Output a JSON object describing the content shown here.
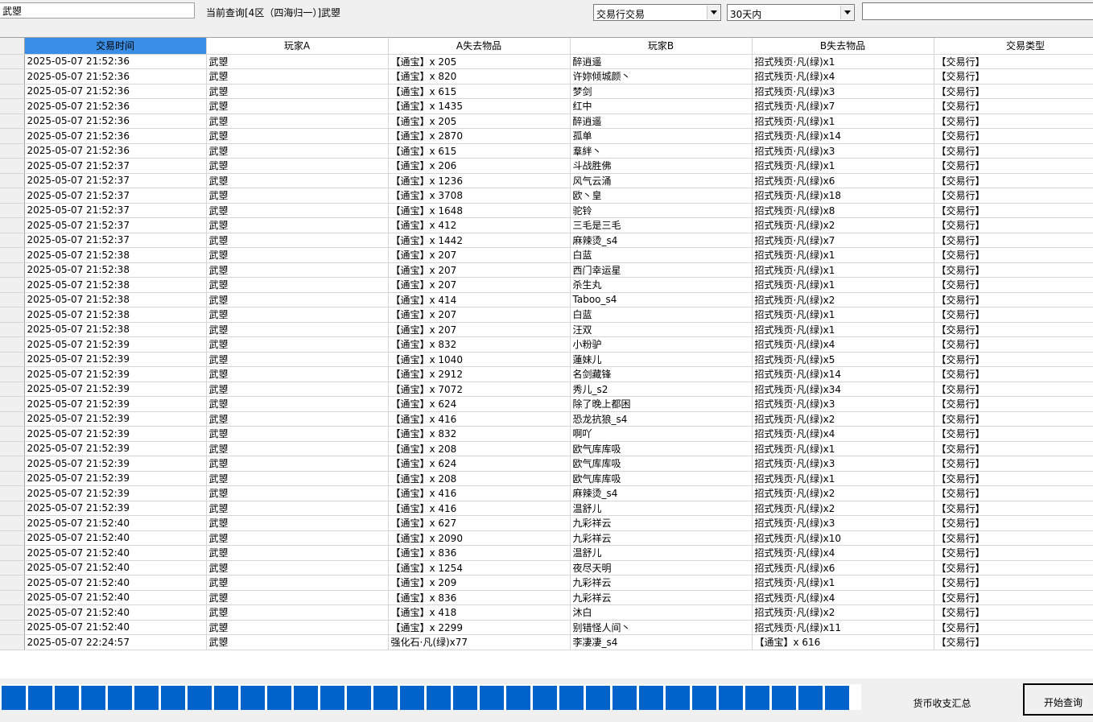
{
  "search": {
    "player_name": "武曌",
    "query_label": "当前查询[4区（四海归一）]武曌",
    "trade_type": "交易行交易",
    "time_range": "30天内",
    "filter_value": ""
  },
  "table": {
    "columns": [
      "交易时间",
      "玩家A",
      "A失去物品",
      "玩家B",
      "B失去物品",
      "交易类型"
    ],
    "rows": [
      [
        "2025-05-07 21:52:36",
        "武曌",
        "【通宝】x 205",
        "醉逍遥",
        "招式残页·凡(绿)x1",
        "【交易行】"
      ],
      [
        "2025-05-07 21:52:36",
        "武曌",
        "【通宝】x 820",
        "许妳倾城颜丶",
        "招式残页·凡(绿)x4",
        "【交易行】"
      ],
      [
        "2025-05-07 21:52:36",
        "武曌",
        "【通宝】x 615",
        "梦剑",
        "招式残页·凡(绿)x3",
        "【交易行】"
      ],
      [
        "2025-05-07 21:52:36",
        "武曌",
        "【通宝】x 1435",
        "红中",
        "招式残页·凡(绿)x7",
        "【交易行】"
      ],
      [
        "2025-05-07 21:52:36",
        "武曌",
        "【通宝】x 205",
        "醉逍遥",
        "招式残页·凡(绿)x1",
        "【交易行】"
      ],
      [
        "2025-05-07 21:52:36",
        "武曌",
        "【通宝】x 2870",
        "孤单",
        "招式残页·凡(绿)x14",
        "【交易行】"
      ],
      [
        "2025-05-07 21:52:36",
        "武曌",
        "【通宝】x 615",
        "羣絆丶",
        "招式残页·凡(绿)x3",
        "【交易行】"
      ],
      [
        "2025-05-07 21:52:37",
        "武曌",
        "【通宝】x 206",
        "斗战胜佛",
        "招式残页·凡(绿)x1",
        "【交易行】"
      ],
      [
        "2025-05-07 21:52:37",
        "武曌",
        "【通宝】x 1236",
        "风气云涌",
        "招式残页·凡(绿)x6",
        "【交易行】"
      ],
      [
        "2025-05-07 21:52:37",
        "武曌",
        "【通宝】x 3708",
        "欧丶皇",
        "招式残页·凡(绿)x18",
        "【交易行】"
      ],
      [
        "2025-05-07 21:52:37",
        "武曌",
        "【通宝】x 1648",
        "驼铃",
        "招式残页·凡(绿)x8",
        "【交易行】"
      ],
      [
        "2025-05-07 21:52:37",
        "武曌",
        "【通宝】x 412",
        "三毛是三毛",
        "招式残页·凡(绿)x2",
        "【交易行】"
      ],
      [
        "2025-05-07 21:52:37",
        "武曌",
        "【通宝】x 1442",
        "麻辣烫_s4",
        "招式残页·凡(绿)x7",
        "【交易行】"
      ],
      [
        "2025-05-07 21:52:38",
        "武曌",
        "【通宝】x 207",
        "白蓝",
        "招式残页·凡(绿)x1",
        "【交易行】"
      ],
      [
        "2025-05-07 21:52:38",
        "武曌",
        "【通宝】x 207",
        "西门幸运星",
        "招式残页·凡(绿)x1",
        "【交易行】"
      ],
      [
        "2025-05-07 21:52:38",
        "武曌",
        "【通宝】x 207",
        "杀生丸",
        "招式残页·凡(绿)x1",
        "【交易行】"
      ],
      [
        "2025-05-07 21:52:38",
        "武曌",
        "【通宝】x 414",
        "Taboo_s4",
        "招式残页·凡(绿)x2",
        "【交易行】"
      ],
      [
        "2025-05-07 21:52:38",
        "武曌",
        "【通宝】x 207",
        "白蓝",
        "招式残页·凡(绿)x1",
        "【交易行】"
      ],
      [
        "2025-05-07 21:52:38",
        "武曌",
        "【通宝】x 207",
        "汪双",
        "招式残页·凡(绿)x1",
        "【交易行】"
      ],
      [
        "2025-05-07 21:52:39",
        "武曌",
        "【通宝】x 832",
        "小粉驴",
        "招式残页·凡(绿)x4",
        "【交易行】"
      ],
      [
        "2025-05-07 21:52:39",
        "武曌",
        "【通宝】x 1040",
        "蓮妹儿",
        "招式残页·凡(绿)x5",
        "【交易行】"
      ],
      [
        "2025-05-07 21:52:39",
        "武曌",
        "【通宝】x 2912",
        "名剑藏锋",
        "招式残页·凡(绿)x14",
        "【交易行】"
      ],
      [
        "2025-05-07 21:52:39",
        "武曌",
        "【通宝】x 7072",
        "秀儿_s2",
        "招式残页·凡(绿)x34",
        "【交易行】"
      ],
      [
        "2025-05-07 21:52:39",
        "武曌",
        "【通宝】x 624",
        "除了晚上都困",
        "招式残页·凡(绿)x3",
        "【交易行】"
      ],
      [
        "2025-05-07 21:52:39",
        "武曌",
        "【通宝】x 416",
        "恐龙抗狼_s4",
        "招式残页·凡(绿)x2",
        "【交易行】"
      ],
      [
        "2025-05-07 21:52:39",
        "武曌",
        "【通宝】x 832",
        "啊吖",
        "招式残页·凡(绿)x4",
        "【交易行】"
      ],
      [
        "2025-05-07 21:52:39",
        "武曌",
        "【通宝】x 208",
        "欧气库库吸",
        "招式残页·凡(绿)x1",
        "【交易行】"
      ],
      [
        "2025-05-07 21:52:39",
        "武曌",
        "【通宝】x 624",
        "欧气库库吸",
        "招式残页·凡(绿)x3",
        "【交易行】"
      ],
      [
        "2025-05-07 21:52:39",
        "武曌",
        "【通宝】x 208",
        "欧气库库吸",
        "招式残页·凡(绿)x1",
        "【交易行】"
      ],
      [
        "2025-05-07 21:52:39",
        "武曌",
        "【通宝】x 416",
        "麻辣烫_s4",
        "招式残页·凡(绿)x2",
        "【交易行】"
      ],
      [
        "2025-05-07 21:52:39",
        "武曌",
        "【通宝】x 416",
        "温舒儿",
        "招式残页·凡(绿)x2",
        "【交易行】"
      ],
      [
        "2025-05-07 21:52:40",
        "武曌",
        "【通宝】x 627",
        "九彩祥云",
        "招式残页·凡(绿)x3",
        "【交易行】"
      ],
      [
        "2025-05-07 21:52:40",
        "武曌",
        "【通宝】x 2090",
        "九彩祥云",
        "招式残页·凡(绿)x10",
        "【交易行】"
      ],
      [
        "2025-05-07 21:52:40",
        "武曌",
        "【通宝】x 836",
        "温舒儿",
        "招式残页·凡(绿)x4",
        "【交易行】"
      ],
      [
        "2025-05-07 21:52:40",
        "武曌",
        "【通宝】x 1254",
        "夜尽天明",
        "招式残页·凡(绿)x6",
        "【交易行】"
      ],
      [
        "2025-05-07 21:52:40",
        "武曌",
        "【通宝】x 209",
        "九彩祥云",
        "招式残页·凡(绿)x1",
        "【交易行】"
      ],
      [
        "2025-05-07 21:52:40",
        "武曌",
        "【通宝】x 836",
        "九彩祥云",
        "招式残页·凡(绿)x4",
        "【交易行】"
      ],
      [
        "2025-05-07 21:52:40",
        "武曌",
        "【通宝】x 418",
        "沐白",
        "招式残页·凡(绿)x2",
        "【交易行】"
      ],
      [
        "2025-05-07 21:52:40",
        "武曌",
        "【通宝】x 2299",
        "别错怪人间丶",
        "招式残页·凡(绿)x11",
        "【交易行】"
      ],
      [
        "2025-05-07 22:24:57",
        "武曌",
        "强化石·凡(绿)x77",
        "李凄凄_s4",
        "【通宝】x 616",
        "【交易行】"
      ]
    ]
  },
  "buttons": {
    "summary": "货币收支汇总",
    "start": "开始查询"
  },
  "progress": {
    "value": 1.0
  },
  "colors": {
    "accent": "#0063cc",
    "header_highlight": "#3a8ee6"
  }
}
